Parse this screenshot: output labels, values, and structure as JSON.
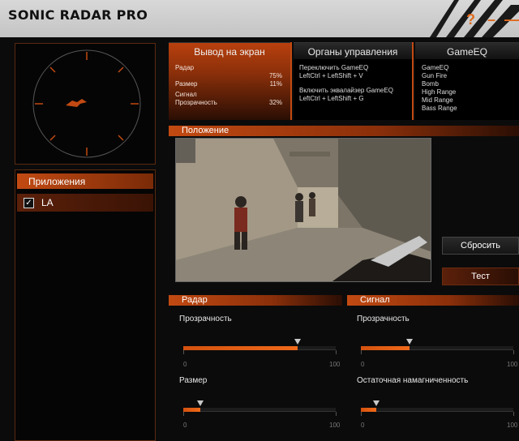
{
  "app": {
    "title": "SONIC RADAR PRO"
  },
  "window_controls": {
    "help": "?",
    "minimize": "–",
    "close": "—"
  },
  "apps": {
    "header": "Приложения",
    "items": [
      {
        "label": "LA",
        "checked": true
      }
    ]
  },
  "display_panel": {
    "title": "Вывод на экран",
    "radar_label": "Радар",
    "radar_value": "75%",
    "size_label": "Размер",
    "size_value": "11%",
    "signal_label": "Сигнал",
    "transparency_label": "Прозрачность",
    "transparency_value": "32%"
  },
  "controls_panel": {
    "title": "Органы управления",
    "switch_label": "Переключить GameEQ",
    "switch_keys": "LeftCtrl + LeftShift + V",
    "enable_label": "Включить эквалайзер GameEQ",
    "enable_keys": "LeftCtrl + LeftShift + G"
  },
  "gameeq_panel": {
    "title": "GameEQ",
    "items": [
      "GameEQ",
      "Gun Fire",
      "Bomb",
      "High Range",
      "Mid Range",
      "Bass Range"
    ]
  },
  "position": {
    "header": "Положение",
    "reset_button": "Сбросить",
    "test_button": "Тест"
  },
  "radar_section": {
    "header": "Радар",
    "transparency_label": "Прозрачность",
    "transparency_value": 75,
    "size_label": "Размер",
    "size_value": 11,
    "min": "0",
    "max": "100"
  },
  "signal_section": {
    "header": "Сигнал",
    "transparency_label": "Прозрачность",
    "transparency_value": 32,
    "afterglow_label": "Остаточная намагниченность",
    "afterglow_value": 10,
    "min": "0",
    "max": "100"
  },
  "colors": {
    "accent": "#e06a1c",
    "accent_dark": "#8a2f0a",
    "background": "#0b0b0b"
  }
}
